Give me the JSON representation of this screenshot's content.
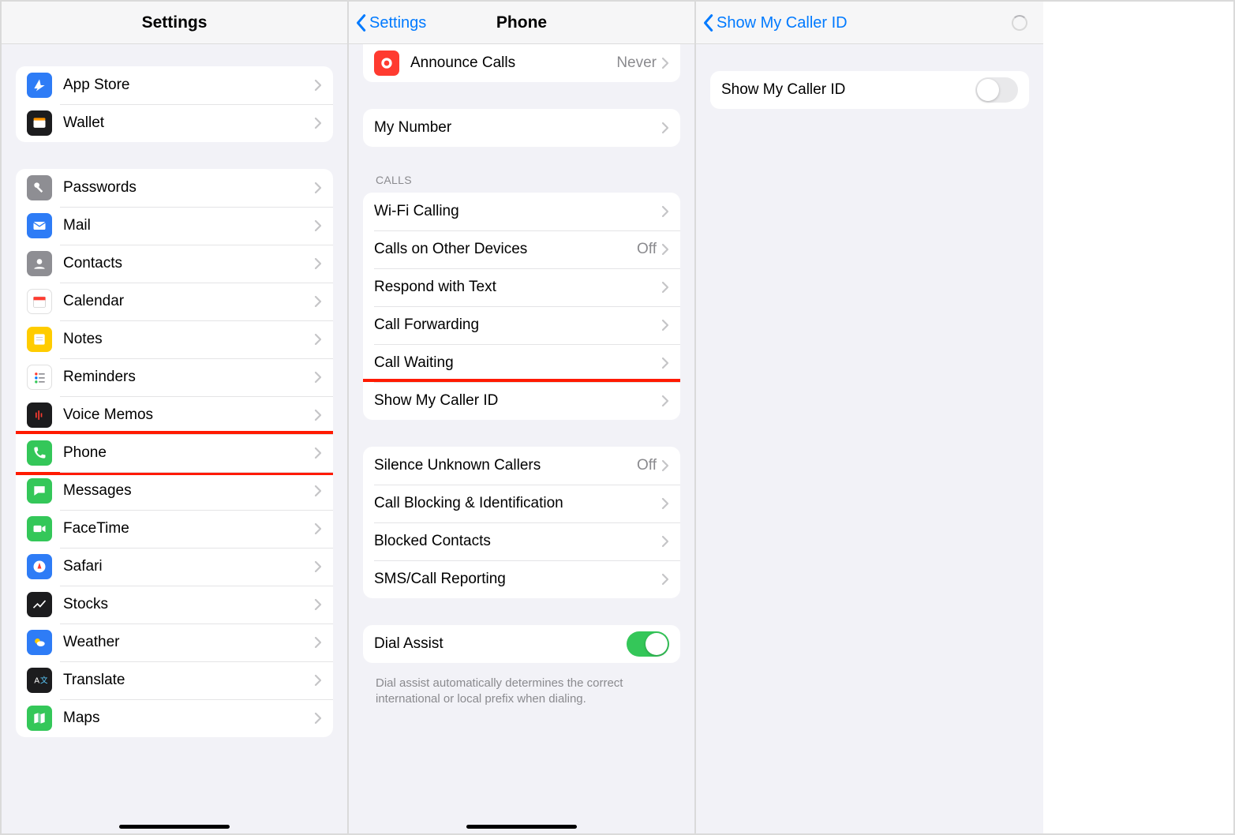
{
  "pane1": {
    "title": "Settings",
    "group1": [
      {
        "id": "app-store",
        "label": "App Store",
        "iconBg": "bg-blue",
        "iconGlyph": "appstore"
      },
      {
        "id": "wallet",
        "label": "Wallet",
        "iconBg": "bg-black",
        "iconGlyph": "wallet"
      }
    ],
    "group2": [
      {
        "id": "passwords",
        "label": "Passwords",
        "iconBg": "bg-gray",
        "iconGlyph": "key"
      },
      {
        "id": "mail",
        "label": "Mail",
        "iconBg": "bg-blue",
        "iconGlyph": "mail"
      },
      {
        "id": "contacts",
        "label": "Contacts",
        "iconBg": "bg-gray",
        "iconGlyph": "person"
      },
      {
        "id": "calendar",
        "label": "Calendar",
        "iconBg": "bg-white",
        "iconGlyph": "calendar"
      },
      {
        "id": "notes",
        "label": "Notes",
        "iconBg": "bg-yellow",
        "iconGlyph": "notes"
      },
      {
        "id": "reminders",
        "label": "Reminders",
        "iconBg": "bg-white",
        "iconGlyph": "reminders"
      },
      {
        "id": "voicememos",
        "label": "Voice Memos",
        "iconBg": "bg-black",
        "iconGlyph": "voice"
      },
      {
        "id": "phone",
        "label": "Phone",
        "iconBg": "bg-green",
        "iconGlyph": "phone",
        "highlight": true
      },
      {
        "id": "messages",
        "label": "Messages",
        "iconBg": "bg-green",
        "iconGlyph": "bubble"
      },
      {
        "id": "facetime",
        "label": "FaceTime",
        "iconBg": "bg-green",
        "iconGlyph": "video"
      },
      {
        "id": "safari",
        "label": "Safari",
        "iconBg": "bg-blue",
        "iconGlyph": "compass"
      },
      {
        "id": "stocks",
        "label": "Stocks",
        "iconBg": "bg-black",
        "iconGlyph": "stocks"
      },
      {
        "id": "weather",
        "label": "Weather",
        "iconBg": "bg-blue",
        "iconGlyph": "weather"
      },
      {
        "id": "translate",
        "label": "Translate",
        "iconBg": "bg-black",
        "iconGlyph": "translate"
      },
      {
        "id": "maps",
        "label": "Maps",
        "iconBg": "bg-green",
        "iconGlyph": "maps"
      }
    ]
  },
  "pane2": {
    "backLabel": "Settings",
    "title": "Phone",
    "partialTopRow": {
      "id": "announce",
      "label": "Announce Calls",
      "value": "Never",
      "iconBg": "bg-red",
      "iconGlyph": "siri"
    },
    "groupMyNumber": [
      {
        "id": "my-number",
        "label": "My Number"
      }
    ],
    "callsHeader": "CALLS",
    "groupCalls": [
      {
        "id": "wifi-calling",
        "label": "Wi-Fi Calling"
      },
      {
        "id": "calls-other",
        "label": "Calls on Other Devices",
        "value": "Off"
      },
      {
        "id": "respond-text",
        "label": "Respond with Text"
      },
      {
        "id": "call-fwd",
        "label": "Call Forwarding"
      },
      {
        "id": "call-waiting",
        "label": "Call Waiting"
      },
      {
        "id": "caller-id",
        "label": "Show My Caller ID",
        "highlight": true
      }
    ],
    "groupBlock": [
      {
        "id": "silence-unknown",
        "label": "Silence Unknown Callers",
        "value": "Off"
      },
      {
        "id": "call-block-id",
        "label": "Call Blocking & Identification"
      },
      {
        "id": "blocked",
        "label": "Blocked Contacts"
      },
      {
        "id": "sms-report",
        "label": "SMS/Call Reporting"
      }
    ],
    "groupDial": [
      {
        "id": "dial-assist",
        "label": "Dial Assist",
        "toggle": "on"
      }
    ],
    "dialFooter": "Dial assist automatically determines the correct international or local prefix when dialing."
  },
  "pane3": {
    "backLabel": "Show My Caller ID",
    "showSpinner": true,
    "row": {
      "id": "show-caller-id-toggle",
      "label": "Show My Caller ID",
      "toggle": "off",
      "highlight": true
    }
  }
}
